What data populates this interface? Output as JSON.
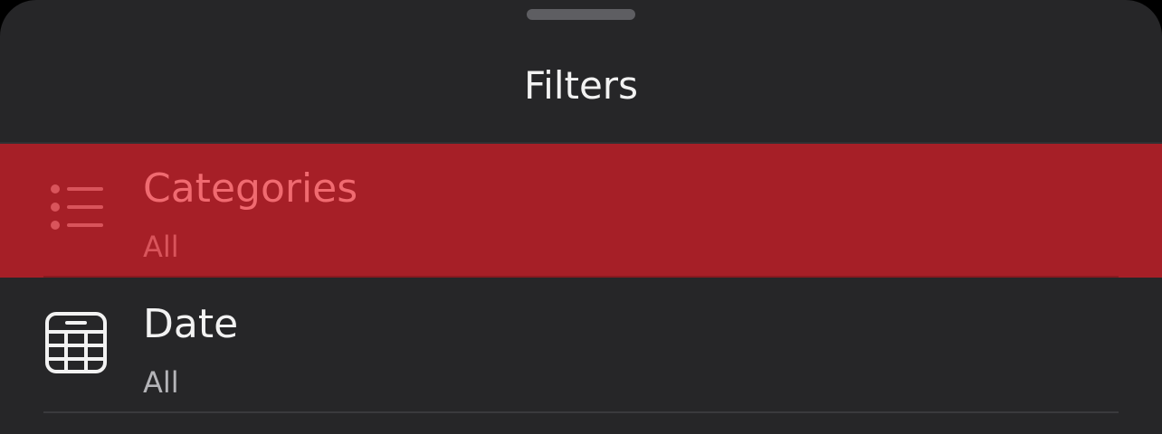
{
  "sheet": {
    "title": "Filters"
  },
  "filters": [
    {
      "label": "Categories",
      "value": "All",
      "icon": "list-icon",
      "selected": true
    },
    {
      "label": "Date",
      "value": "All",
      "icon": "calendar-icon",
      "selected": false
    }
  ],
  "colors": {
    "background": "#262628",
    "selected_row": "#a61f27",
    "selected_text": "#f06a70",
    "primary_text": "#f2f2f2",
    "secondary_text": "#b4b4b8"
  }
}
